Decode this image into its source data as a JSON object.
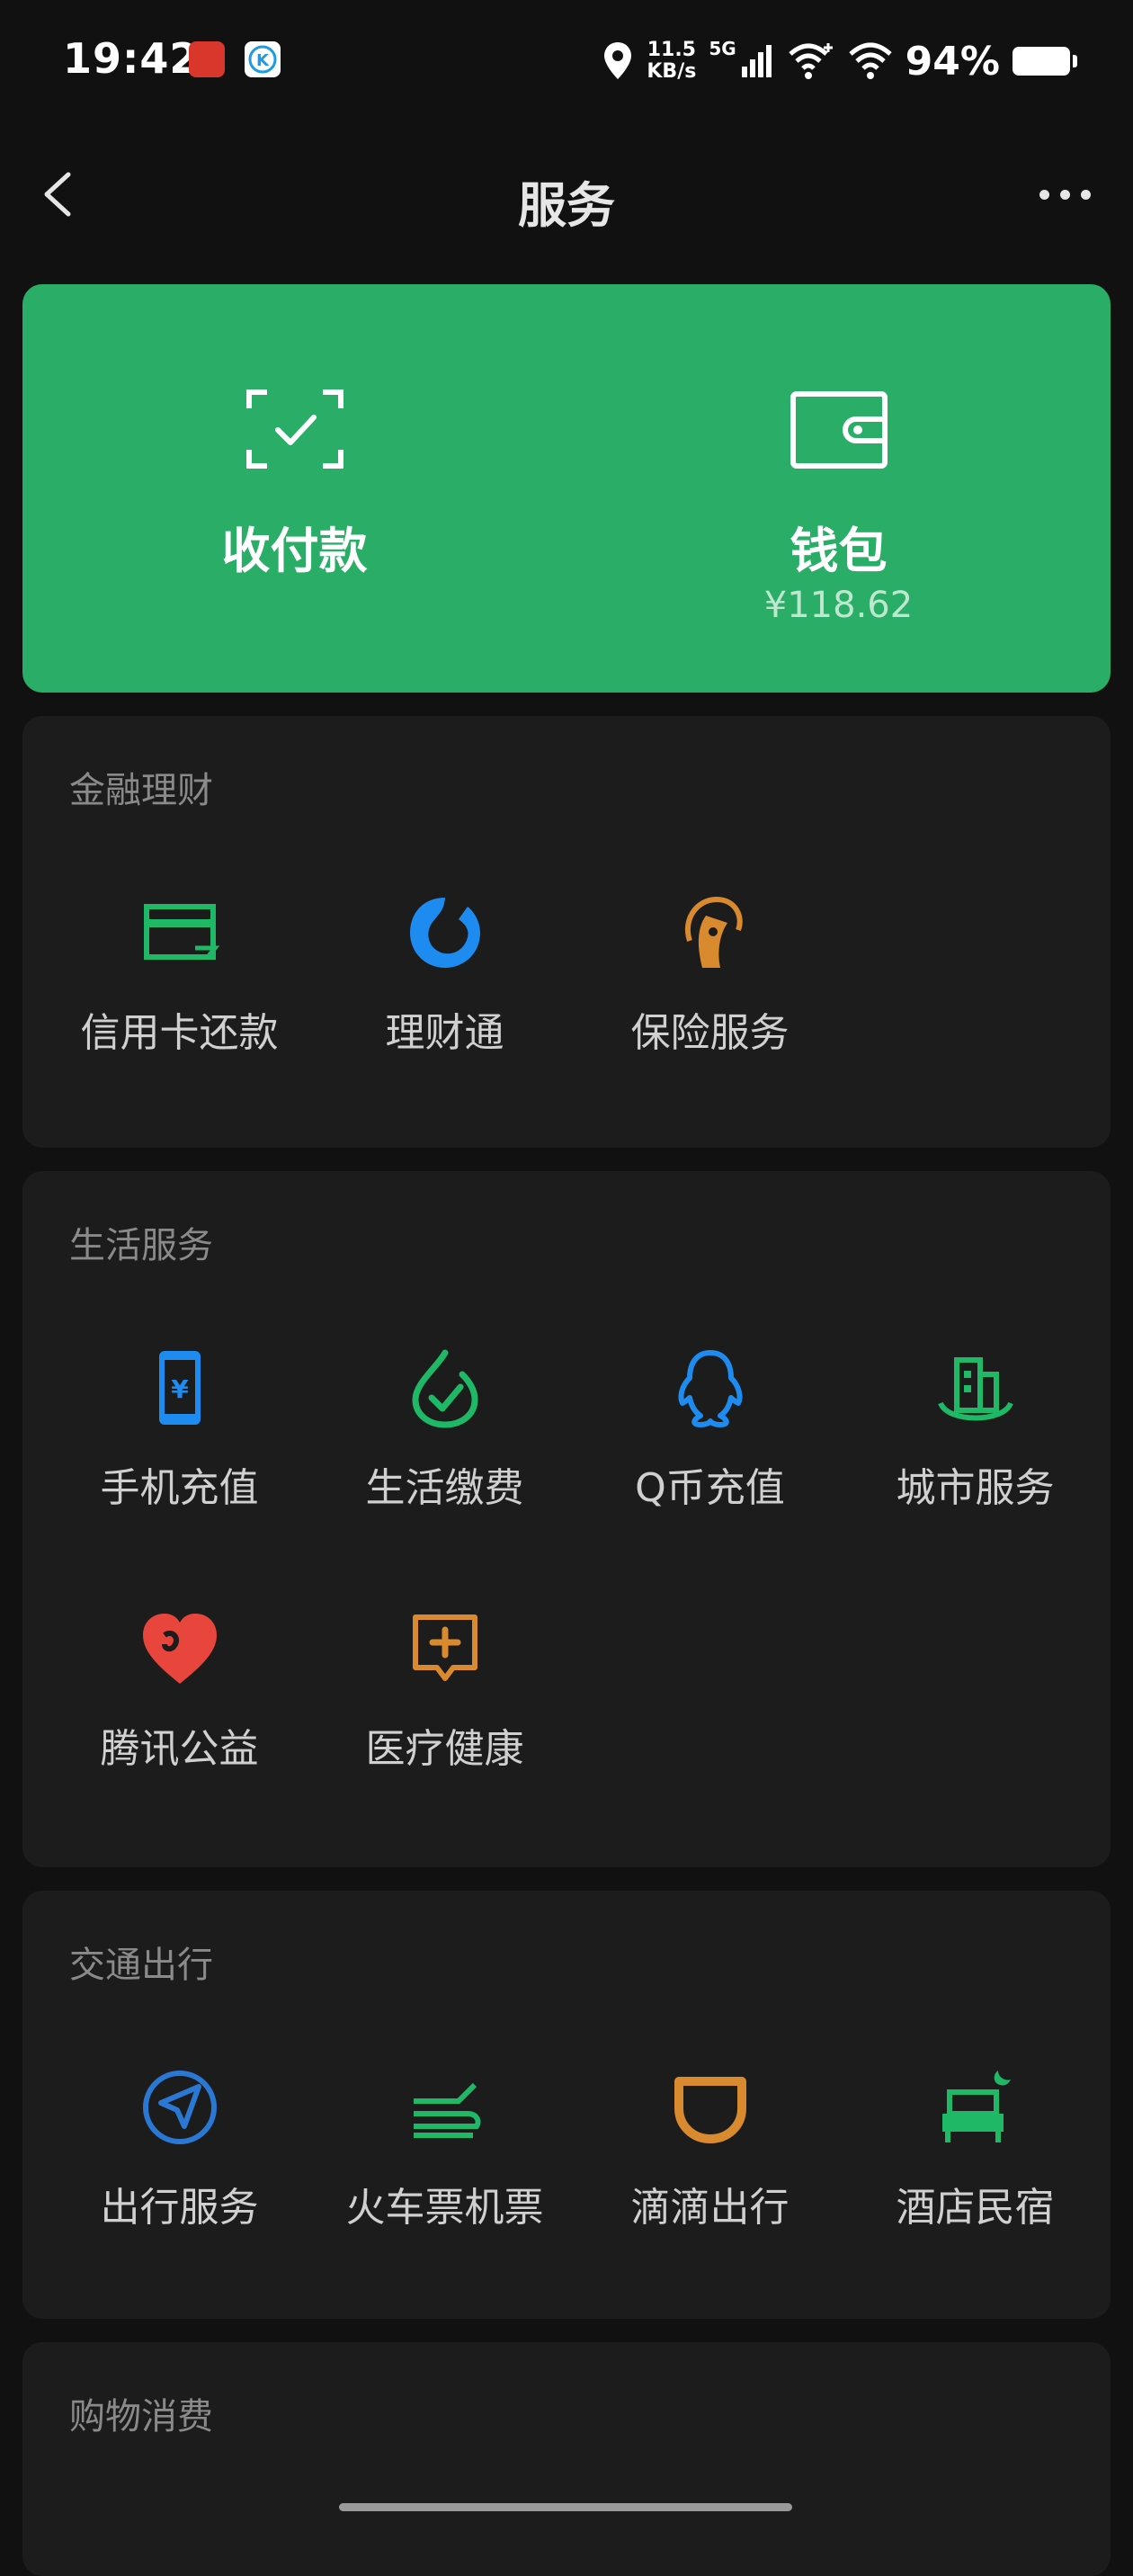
{
  "status_bar": {
    "time": "19:42",
    "speed_value": "11.5",
    "speed_unit": "KB/s",
    "network": "5G",
    "battery": "94%"
  },
  "nav": {
    "title": "服务"
  },
  "top_card": {
    "pay_label": "收付款",
    "wallet_label": "钱包",
    "wallet_balance": "¥118.62",
    "background_color": "#2aae67"
  },
  "sections": {
    "finance": {
      "title": "金融理财",
      "items": [
        {
          "label": "信用卡还款",
          "icon": "credit-card-icon",
          "color": "#1fb866"
        },
        {
          "label": "理财通",
          "icon": "wealth-icon",
          "color": "#1e8bf0"
        },
        {
          "label": "保险服务",
          "icon": "insurance-icon",
          "color": "#d98a2f"
        }
      ]
    },
    "life": {
      "title": "生活服务",
      "items": [
        {
          "label": "手机充值",
          "icon": "phone-recharge-icon",
          "color": "#1e8bf0"
        },
        {
          "label": "生活缴费",
          "icon": "utility-payment-icon",
          "color": "#1fb866"
        },
        {
          "label": "Q币充值",
          "icon": "qq-coin-icon",
          "color": "#1e8bf0"
        },
        {
          "label": "城市服务",
          "icon": "city-service-icon",
          "color": "#1fb866"
        },
        {
          "label": "腾讯公益",
          "icon": "charity-heart-icon",
          "color": "#e8453c"
        },
        {
          "label": "医疗健康",
          "icon": "medical-icon",
          "color": "#d98a2f"
        }
      ]
    },
    "transport": {
      "title": "交通出行",
      "items": [
        {
          "label": "出行服务",
          "icon": "navigation-icon",
          "color": "#2b78d4"
        },
        {
          "label": "火车票机票",
          "icon": "train-plane-icon",
          "color": "#1fb866"
        },
        {
          "label": "滴滴出行",
          "icon": "didi-icon",
          "color": "#d98a2f"
        },
        {
          "label": "酒店民宿",
          "icon": "hotel-icon",
          "color": "#1fb866"
        }
      ]
    },
    "shopping": {
      "title": "购物消费"
    }
  }
}
